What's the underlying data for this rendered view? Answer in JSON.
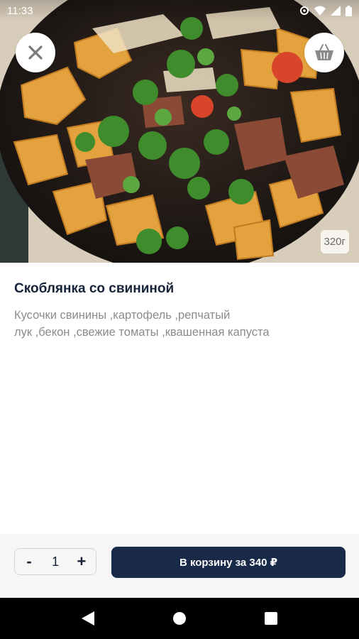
{
  "status_bar": {
    "time": "11:33",
    "icons": [
      "settings-icon",
      "wifi-icon",
      "signal-icon",
      "battery-icon"
    ]
  },
  "hero": {
    "image": "pan-of-fried-potatoes-with-pork-cabbage-and-parsley",
    "weight": "320г",
    "close_icon": "close-icon",
    "basket_icon": "basket-icon"
  },
  "dish": {
    "title": "Скоблянка со свининой",
    "description_line1": "Кусочки свинины ,картофель ,репчатый",
    "description_line2": "лук ,бекон ,свежие томаты ,квашенная капуста"
  },
  "order": {
    "decrement_label": "-",
    "quantity": "1",
    "increment_label": "+",
    "add_to_cart_label": "В корзину за 340 ₽"
  },
  "nav": {
    "back_icon": "back-triangle-icon",
    "home_icon": "home-circle-icon",
    "recents_icon": "recents-square-icon"
  },
  "colors": {
    "primary": "#182a47",
    "title": "#162339",
    "description": "#8b8b8b",
    "action_background": "#f6f6f6"
  }
}
